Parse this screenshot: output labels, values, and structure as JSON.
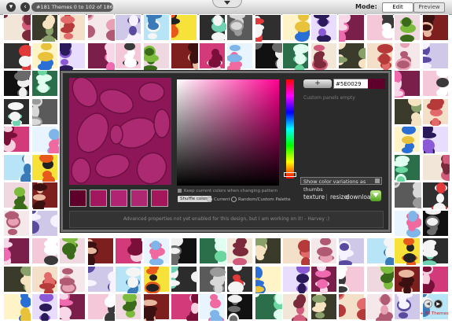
{
  "topbar": {
    "count_text": "#181 Themes 0 to 102 of 1867",
    "mode_label": "Mode:",
    "edit_label": "Edit",
    "preview_label": "Preview"
  },
  "editor": {
    "add_label": "+",
    "hex_value": "#5E0029",
    "selected_color": "#5e0029",
    "preview_color": "#8d1658",
    "custom_empty_text": "Custom panels empty",
    "variations_label": "Show color variations as thumbs",
    "palette": [
      "#5e0029",
      "#a2175d",
      "#b02473",
      "#ad2871",
      "#a4185b"
    ],
    "keep_label": "Keep current colors when changing pattern",
    "shuffle_label": "Shuffle colors",
    "radio_current": "Current",
    "radio_random": "Random/Custom Palette",
    "texture_label": "texture",
    "resize_label": "resize",
    "download_label": "download",
    "separator": "|",
    "message": "Advanced properties not yet enabled for this design, but I am working on it! - Harvey :)"
  },
  "footer": {
    "all_themes_label": "+ All Themes"
  }
}
